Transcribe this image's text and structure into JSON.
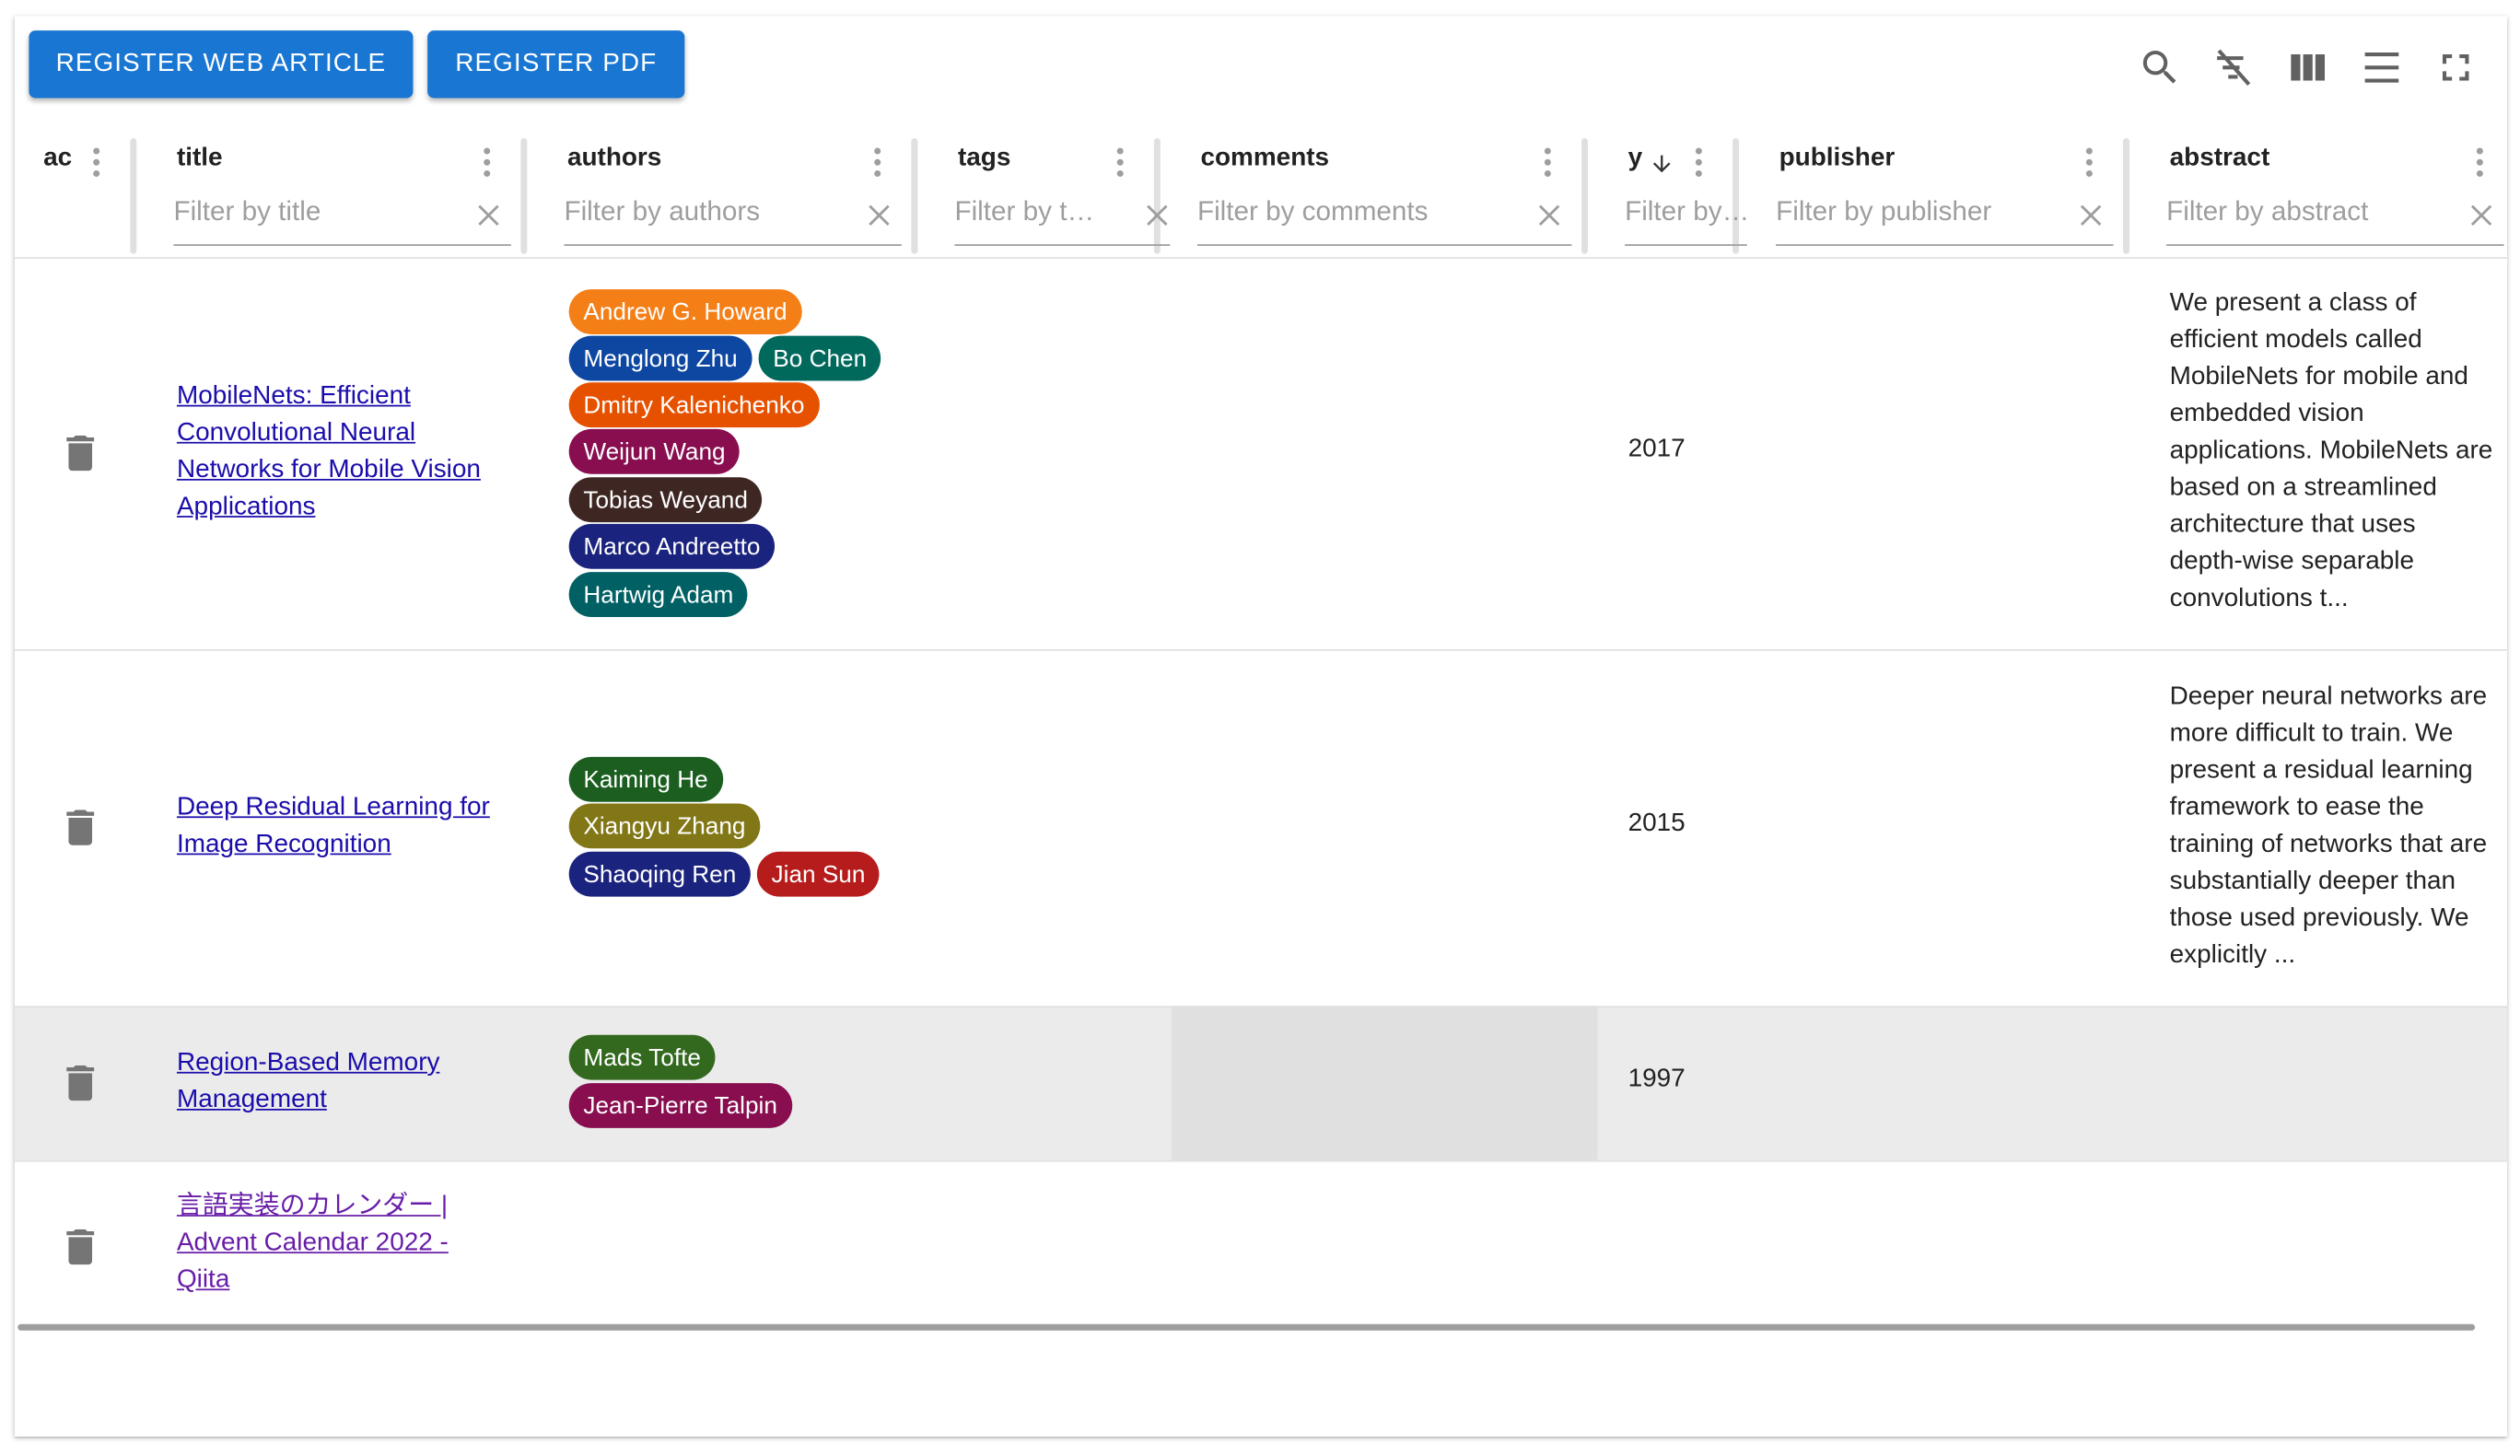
{
  "toolbar": {
    "register_web": "REGISTER WEB ARTICLE",
    "register_pdf": "REGISTER PDF",
    "icons": [
      "search-icon",
      "clear-filter-icon",
      "columns-icon",
      "density-icon",
      "fullscreen-icon"
    ]
  },
  "columns": [
    {
      "key": "actions",
      "label": "ac",
      "filter": null
    },
    {
      "key": "title",
      "label": "title",
      "filter": "Filter by title"
    },
    {
      "key": "authors",
      "label": "authors",
      "filter": "Filter by authors"
    },
    {
      "key": "tags",
      "label": "tags",
      "filter": "Filter by t…"
    },
    {
      "key": "comments",
      "label": "comments",
      "filter": "Filter by comments"
    },
    {
      "key": "year",
      "label": "y",
      "sort": "desc",
      "filter": "Filter by…"
    },
    {
      "key": "publisher",
      "label": "publisher",
      "filter": "Filter by publisher"
    },
    {
      "key": "abstract",
      "label": "abstract",
      "filter": "Filter by abstract"
    }
  ],
  "rows": [
    {
      "title_lines": [
        "MobileNets: Efficient",
        "Convolutional Neural",
        "Networks for Mobile Vision",
        "Applications"
      ],
      "authors": [
        {
          "name": "Andrew G. Howard",
          "color": "#f57f17"
        },
        {
          "name": "Menglong Zhu",
          "color": "#0d47a1"
        },
        {
          "name": "Bo Chen",
          "color": "#00695c"
        },
        {
          "name": "Dmitry Kalenichenko",
          "color": "#e65100"
        },
        {
          "name": "Weijun Wang",
          "color": "#880e4f"
        },
        {
          "name": "Tobias Weyand",
          "color": "#3e2723"
        },
        {
          "name": "Marco Andreetto",
          "color": "#1a237e"
        },
        {
          "name": "Hartwig Adam",
          "color": "#006064"
        }
      ],
      "year": "2017",
      "abstract_lines": [
        "We present a class of",
        "efficient models called",
        "MobileNets for mobile and",
        "embedded vision",
        "applications. MobileNets are",
        "based on a streamlined",
        "architecture that uses",
        "depth-wise separable",
        "convolutions t..."
      ]
    },
    {
      "title_lines": [
        "Deep Residual Learning for",
        "Image Recognition"
      ],
      "authors": [
        {
          "name": "Kaiming He",
          "color": "#1b5e20"
        },
        {
          "name": "Xiangyu Zhang",
          "color": "#827717"
        },
        {
          "name": "Shaoqing Ren",
          "color": "#1a237e"
        },
        {
          "name": "Jian Sun",
          "color": "#b71c1c"
        }
      ],
      "year": "2015",
      "abstract_lines": [
        "Deeper neural networks are",
        "more difficult to train. We",
        "present a residual learning",
        "framework to ease the",
        "training of networks that are",
        "substantially deeper than",
        "those used previously. We",
        "explicitly ..."
      ]
    },
    {
      "title_lines": [
        "Region-Based Memory",
        "Management"
      ],
      "authors": [
        {
          "name": "Mads Tofte",
          "color": "#33691e"
        },
        {
          "name": "Jean-Pierre Talpin",
          "color": "#880e4f"
        }
      ],
      "year": "1997",
      "abstract_lines": []
    },
    {
      "title_lines": [
        "言語実装のカレンダー |",
        "Advent Calendar 2022 -",
        "Qiita"
      ],
      "authors": [],
      "year": "",
      "abstract_lines": []
    }
  ]
}
